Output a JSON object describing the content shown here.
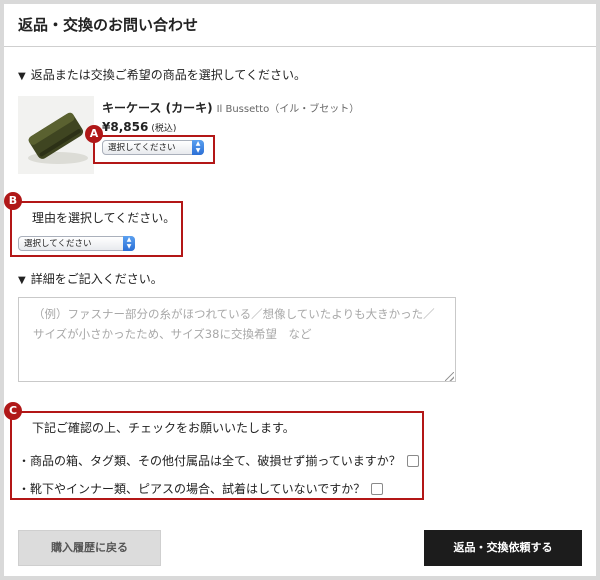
{
  "header": {
    "title": "返品・交換のお問い合わせ"
  },
  "product_section": {
    "heading": "返品または交換ご希望の商品を選択してください。"
  },
  "product": {
    "name": "キーケース (カーキ)",
    "brand": "Il Bussetto（イル・ブセット）",
    "price": "¥8,856",
    "tax": "(税込)",
    "select_value": "選択してください"
  },
  "reason": {
    "heading": "理由を選択してください。",
    "select_value": "選択してください"
  },
  "details": {
    "heading": "詳細をご記入ください。",
    "placeholder": "（例）ファスナー部分の糸がほつれている／想像していたよりも大きかった／\nサイズが小さかったため、サイズ38に交換希望　など"
  },
  "confirm": {
    "heading": "下記ご確認の上、チェックをお願いいたします。",
    "items": [
      "・商品の箱、タグ類、その他付属品は全て、破損せず揃っていますか？",
      "・靴下やインナー類、ピアスの場合、試着はしていないですか？"
    ]
  },
  "annotations": {
    "a": "A",
    "b": "B",
    "c": "C",
    "color": "#b31717"
  },
  "buttons": {
    "back": "購入履歴に戻る",
    "submit": "返品・交換依頼する"
  },
  "icons": {
    "section_marker": "triangle-down-icon",
    "select_arrow": "updown-arrows-icon"
  }
}
